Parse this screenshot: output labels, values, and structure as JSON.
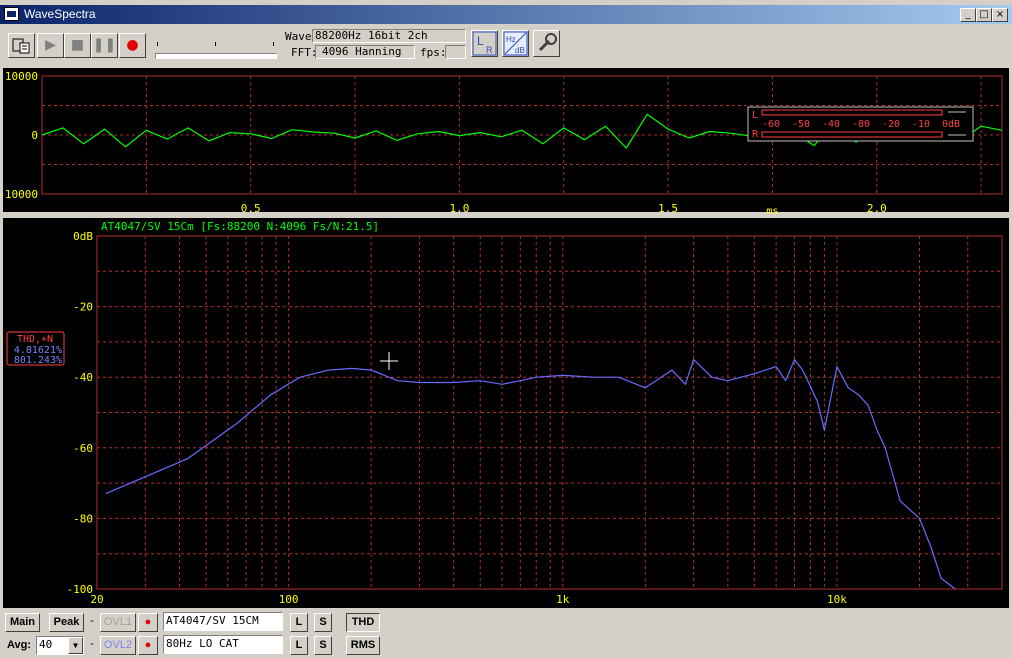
{
  "app": {
    "title": "WaveSpectra",
    "window_buttons": [
      "_",
      "□",
      "×"
    ]
  },
  "toolbar": {
    "wave_label": "Wave:",
    "wave_value": "88200Hz 16bit 2ch",
    "fft_label": "FFT:",
    "fft_value": "4096 Hanning",
    "fps_label": "fps:",
    "fps_value": ""
  },
  "waveform": {
    "y_ticks": [
      "10000",
      "0",
      "-10000"
    ],
    "x_ticks": [
      "0.5",
      "1.0",
      "1.5",
      "2.0"
    ],
    "x_unit": "ms",
    "level_meter": {
      "channels": [
        "L",
        "R"
      ],
      "scale": [
        "-60",
        "-50",
        "-40",
        "-80",
        "-20",
        "-10",
        "0dB"
      ]
    }
  },
  "spectrum": {
    "header": "AT4047/SV 15Cm  [Fs:88200 N:4096 Fs/N:21.5]",
    "thd_label": "THD,+N",
    "thd_value": "4.81621%",
    "thdn_value": "801.243%"
  },
  "bottom": {
    "main_label": "Main",
    "peak_label": "Peak",
    "ovl1_label": "OVL1",
    "ovl2_label": "OVL2",
    "avg_label": "Avg:",
    "avg_value": "40",
    "ovl1_text": "AT4047/SV 15CM",
    "ovl2_text": "80Hz LO CAT",
    "l_label": "L",
    "s_label": "S",
    "thd_button": "THD",
    "rms_button": "RMS",
    "dash": "-"
  },
  "colors": {
    "waveform": "#00ff00",
    "spectrum": "#6a6aff",
    "grid": "#b03030",
    "axis_text": "#ffff00",
    "header_text": "#00ff00",
    "thd_box": "#ff4040",
    "titlebar": "#0a246a"
  },
  "chart_data": [
    {
      "type": "line",
      "name": "waveform",
      "xlabel": "ms",
      "ylabel": "",
      "xlim": [
        0,
        2.3
      ],
      "ylim": [
        -10000,
        10000
      ],
      "grid": true,
      "x": [
        0.0,
        0.05,
        0.1,
        0.15,
        0.2,
        0.25,
        0.3,
        0.35,
        0.4,
        0.45,
        0.5,
        0.55,
        0.6,
        0.65,
        0.7,
        0.75,
        0.8,
        0.85,
        0.9,
        0.95,
        1.0,
        1.05,
        1.1,
        1.15,
        1.2,
        1.25,
        1.3,
        1.35,
        1.4,
        1.45,
        1.5,
        1.55,
        1.6,
        1.65,
        1.7,
        1.75,
        1.8,
        1.85,
        1.9,
        1.95,
        2.0,
        2.05,
        2.1,
        2.15,
        2.2,
        2.25,
        2.3
      ],
      "y": [
        0,
        1200,
        -1500,
        1000,
        -2000,
        800,
        -700,
        1200,
        -1000,
        400,
        200,
        -600,
        900,
        500,
        300,
        -500,
        700,
        -900,
        200,
        600,
        -100,
        400,
        -300,
        800,
        -1500,
        1200,
        -800,
        1500,
        -2200,
        3500,
        1000,
        -500,
        600,
        300,
        -200,
        100,
        500,
        -1800,
        2800,
        -1200,
        900,
        1800,
        -600,
        2200,
        -1000,
        1500,
        800
      ]
    },
    {
      "type": "line",
      "name": "spectrum",
      "title": "AT4047/SV 15Cm  [Fs:88200 N:4096 Fs/N:21.5]",
      "xlabel": "",
      "ylabel": "",
      "xscale": "log",
      "xlim": [
        20,
        40000
      ],
      "ylim": [
        -100,
        0
      ],
      "y_ticks": [
        "0dB",
        "-20",
        "-40",
        "-60",
        "-80",
        "-100"
      ],
      "x_ticks": [
        "20",
        "100",
        "1k",
        "10k"
      ],
      "grid": true,
      "x": [
        21.5,
        43,
        65,
        86,
        110,
        140,
        170,
        200,
        250,
        300,
        400,
        500,
        600,
        700,
        800,
        1000,
        1300,
        1600,
        2000,
        2500,
        2800,
        3000,
        3500,
        4000,
        5000,
        6000,
        6500,
        7000,
        7500,
        8500,
        9000,
        10000,
        11000,
        12000,
        13000,
        14000,
        15000,
        17000,
        20000,
        22000,
        24000,
        26000,
        27000
      ],
      "y": [
        -73,
        -63,
        -53,
        -45,
        -40,
        -38,
        -37.5,
        -38,
        -41,
        -41.5,
        -41.5,
        -41,
        -42,
        -41,
        -40,
        -39.5,
        -40,
        -40,
        -43,
        -38,
        -42,
        -35,
        -40,
        -41,
        -39,
        -37,
        -41,
        -35,
        -38,
        -47,
        -55,
        -37,
        -43,
        -45,
        -48,
        -55,
        -60,
        -75,
        -80,
        -88,
        -97,
        -99,
        -100
      ]
    }
  ]
}
